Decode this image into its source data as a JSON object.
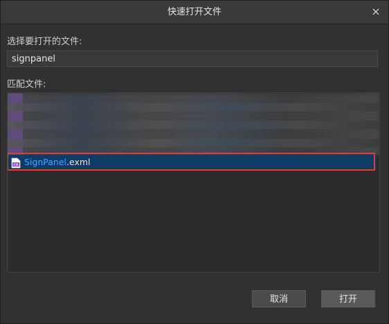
{
  "window": {
    "title": "快速打开文件"
  },
  "search": {
    "label": "选择要打开的文件:",
    "value": "signpanel"
  },
  "matches": {
    "label": "匹配文件:",
    "selected_item": {
      "match_text": "SignPanel",
      "rest_text": ".exml",
      "icon": "exml-file-icon"
    }
  },
  "buttons": {
    "cancel": "取消",
    "open": "打开"
  },
  "colors": {
    "selection": "#0f3b67",
    "highlight_border": "#e23b3b",
    "match_text": "#4aa3ff"
  }
}
